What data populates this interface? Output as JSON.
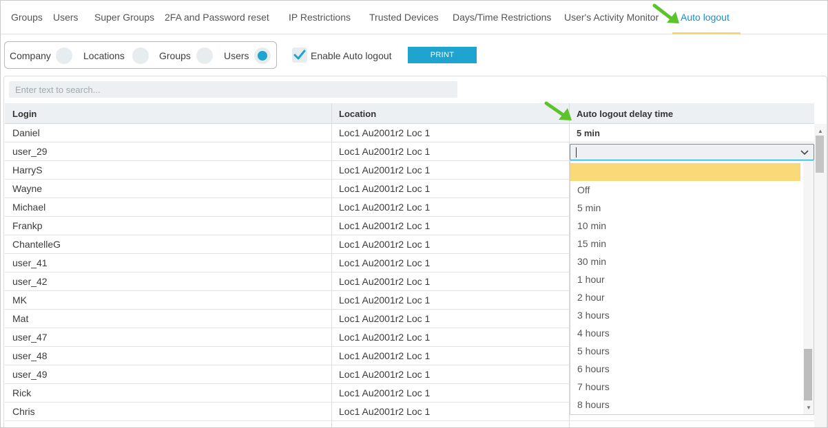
{
  "tabs": [
    {
      "label": "Groups"
    },
    {
      "label": "Users"
    },
    {
      "label": "Super Groups"
    },
    {
      "label": "2FA and Password reset"
    },
    {
      "label": "IP Restrictions"
    },
    {
      "label": "Trusted Devices"
    },
    {
      "label": "Days/Time Restrictions"
    },
    {
      "label": "User's Activity Monitor"
    },
    {
      "label": "Auto logout",
      "active": true
    }
  ],
  "scope": {
    "options": [
      "Company",
      "Locations",
      "Groups",
      "Users"
    ],
    "selected": "Users"
  },
  "enable_auto_logout": {
    "label": "Enable Auto logout",
    "checked": true
  },
  "print_label": "PRINT",
  "search": {
    "placeholder": "Enter text to search...",
    "value": ""
  },
  "table": {
    "columns": [
      "Login",
      "Location",
      "Auto logout delay time"
    ],
    "rows": [
      {
        "login": "Daniel",
        "location": "Loc1 Au2001r2 Loc 1",
        "delay": "5 min"
      },
      {
        "login": "user_29",
        "location": "Loc1 Au2001r2 Loc 1",
        "delay": ""
      },
      {
        "login": "HarryS",
        "location": "Loc1 Au2001r2 Loc 1",
        "delay": ""
      },
      {
        "login": "Wayne",
        "location": "Loc1 Au2001r2 Loc 1",
        "delay": ""
      },
      {
        "login": "Michael",
        "location": "Loc1 Au2001r2 Loc 1",
        "delay": ""
      },
      {
        "login": "Frankp",
        "location": "Loc1 Au2001r2 Loc 1",
        "delay": ""
      },
      {
        "login": "ChantelleG",
        "location": "Loc1 Au2001r2 Loc 1",
        "delay": ""
      },
      {
        "login": "user_41",
        "location": "Loc1 Au2001r2 Loc 1",
        "delay": ""
      },
      {
        "login": "user_42",
        "location": "Loc1 Au2001r2 Loc 1",
        "delay": ""
      },
      {
        "login": "MK",
        "location": "Loc1 Au2001r2 Loc 1",
        "delay": ""
      },
      {
        "login": "Mat",
        "location": "Loc1 Au2001r2 Loc 1",
        "delay": ""
      },
      {
        "login": "user_47",
        "location": "Loc1 Au2001r2 Loc 1",
        "delay": ""
      },
      {
        "login": "user_48",
        "location": "Loc1 Au2001r2 Loc 1",
        "delay": ""
      },
      {
        "login": "user_49",
        "location": "Loc1 Au2001r2 Loc 1",
        "delay": ""
      },
      {
        "login": "Rick",
        "location": "Loc1 Au2001r2 Loc 1",
        "delay": ""
      },
      {
        "login": "Chris",
        "location": "Loc1 Au2001r2 Loc 1",
        "delay": ""
      }
    ]
  },
  "delay_dropdown": {
    "options": [
      "",
      "Off",
      "5 min",
      "10 min",
      "15 min",
      "30 min",
      "1 hour",
      "2 hour",
      "3 hours",
      "4 hours",
      "5 hours",
      "6 hours",
      "7 hours",
      "8 hours"
    ],
    "highlighted": 0
  },
  "colors": {
    "accent": "#1fa4cf",
    "tab_active": "#1a8fc9",
    "highlight": "#f9d978",
    "arrow": "#5cc42b"
  },
  "icons": [
    "check-icon",
    "chevron-down-icon",
    "green-arrow-icon",
    "scroll-up-arrow",
    "scroll-down-arrow"
  ]
}
